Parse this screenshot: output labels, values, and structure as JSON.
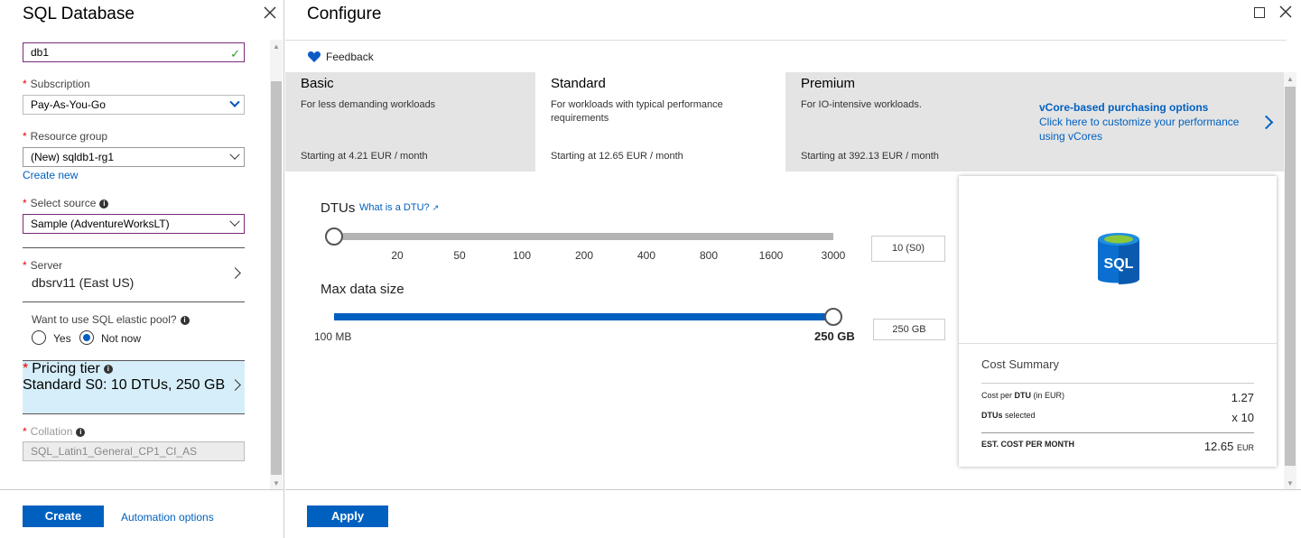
{
  "left_blade": {
    "title": "SQL Database",
    "db_name_value": "db1",
    "subscription": {
      "label": "Subscription",
      "value": "Pay-As-You-Go"
    },
    "resource_group": {
      "label": "Resource group",
      "value": "(New) sqldb1-rg1",
      "create_new": "Create new"
    },
    "select_source": {
      "label": "Select source",
      "value": "Sample (AdventureWorksLT)"
    },
    "server": {
      "label": "Server",
      "value": "dbsrv11 (East US)"
    },
    "elastic_pool": {
      "question": "Want to use SQL elastic pool?",
      "options": [
        "Yes",
        "Not now"
      ],
      "selected": "Not now"
    },
    "pricing_tier": {
      "label": "Pricing tier",
      "value": "Standard S0: 10 DTUs, 250 GB"
    },
    "collation": {
      "label": "Collation",
      "value": "SQL_Latin1_General_CP1_CI_AS"
    },
    "footer": {
      "create": "Create",
      "automation": "Automation options"
    }
  },
  "configure": {
    "title": "Configure",
    "feedback": "Feedback",
    "tiers": [
      {
        "name": "Basic",
        "desc": "For less demanding workloads",
        "price": "Starting at 4.21 EUR / month"
      },
      {
        "name": "Standard",
        "desc": "For workloads with typical performance requirements",
        "price": "Starting at 12.65 EUR / month"
      },
      {
        "name": "Premium",
        "desc": "For IO-intensive workloads.",
        "price": "Starting at 392.13 EUR / month"
      }
    ],
    "selected_tier": "Standard",
    "vcore": {
      "title": "vCore-based purchasing options",
      "desc": "Click here to customize your performance using vCores"
    },
    "dtu": {
      "label": "DTUs",
      "link": "What is a DTU?",
      "ticks": [
        "20",
        "50",
        "100",
        "200",
        "400",
        "800",
        "1600",
        "3000"
      ],
      "value": "10 (S0)",
      "slider_fraction": 0
    },
    "max_data": {
      "label": "Max data size",
      "min": "100 MB",
      "max": "250 GB",
      "value": "250 GB",
      "slider_fraction": 1
    },
    "cost_summary": {
      "icon_text": "SQL",
      "title": "Cost Summary",
      "rows": [
        {
          "label_prefix": "Cost per ",
          "label_bold": "DTU",
          "label_suffix": " (in EUR)",
          "value": "1.27"
        },
        {
          "label_prefix": "",
          "label_bold": "DTUs",
          "label_suffix": " selected",
          "value": "x 10"
        }
      ],
      "total_label": "EST. COST PER MONTH",
      "total_value": "12.65",
      "total_unit": "EUR"
    },
    "apply": "Apply"
  },
  "colors": {
    "accent": "#0060c0",
    "pricing_bg": "#d6eefa",
    "tier_strip": "#e4e4e4",
    "slider_grey": "#b4b4b4"
  }
}
